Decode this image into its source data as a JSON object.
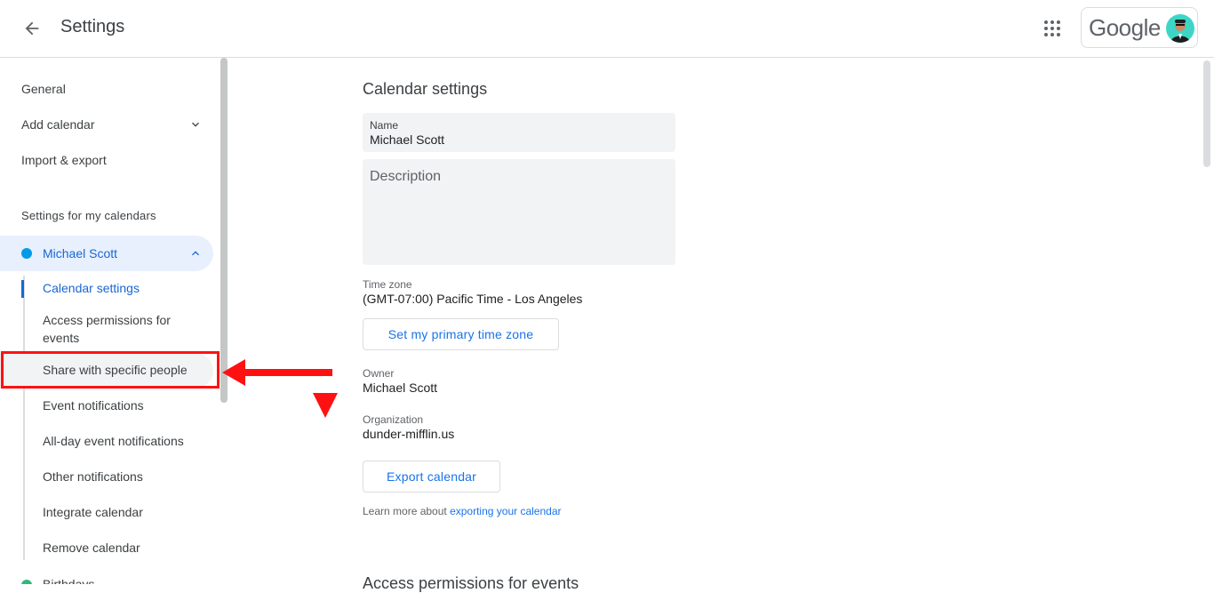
{
  "header": {
    "title": "Settings",
    "logo_text": "Google",
    "back_icon": "arrow-back-icon",
    "apps_icon": "apps-grid-icon"
  },
  "sidebar": {
    "general": "General",
    "add_calendar": "Add calendar",
    "import_export": "Import & export",
    "section_title": "Settings for my calendars",
    "calendar": {
      "name": "Michael Scott",
      "color": "#039be5"
    },
    "sub_items": [
      "Calendar settings",
      "Access permissions for events",
      "Share with specific people",
      "Event notifications",
      "All-day event notifications",
      "Other notifications",
      "Integrate calendar",
      "Remove calendar"
    ],
    "birthdays": {
      "name": "Birthdays",
      "color": "#33b679"
    }
  },
  "main": {
    "title": "Calendar settings",
    "name_label": "Name",
    "name_value": "Michael Scott",
    "description_placeholder": "Description",
    "timezone_label": "Time zone",
    "timezone_value": "(GMT-07:00) Pacific Time - Los Angeles",
    "set_tz_button": "Set my primary time zone",
    "owner_label": "Owner",
    "owner_value": "Michael Scott",
    "org_label": "Organization",
    "org_value": "dunder-mifflin.us",
    "export_button": "Export calendar",
    "learn_prefix": "Learn more about",
    "learn_link": "exporting your calendar",
    "next_section": "Access permissions for events"
  },
  "colors": {
    "accent": "#1a73e8",
    "active_text": "#1967d2",
    "annotation_red": "#ff1111"
  }
}
